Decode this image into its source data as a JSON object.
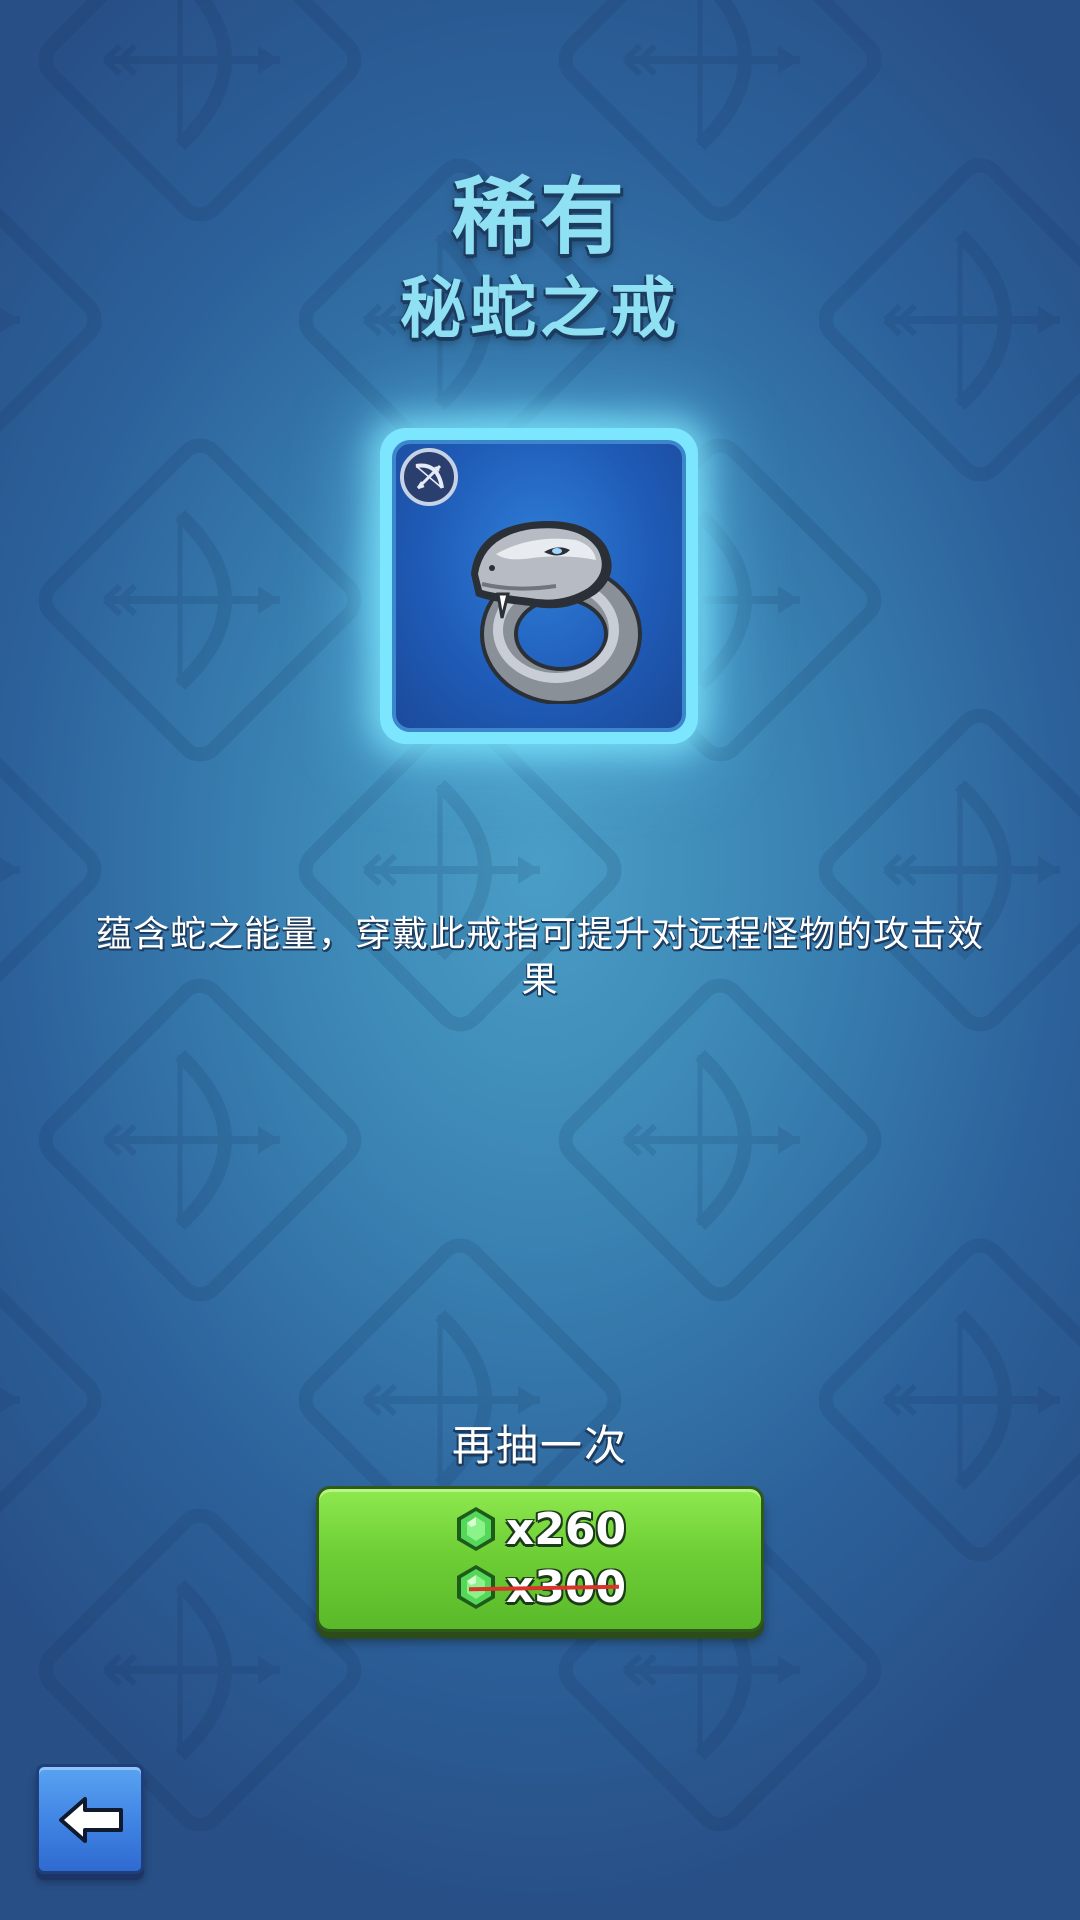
{
  "header": {
    "rarity": "稀有",
    "item_name": "秘蛇之戒"
  },
  "item": {
    "type_icon": "bow-icon",
    "art": "serpent-ring"
  },
  "description": "蕴含蛇之能量，穿戴此戒指可提升对远程怪物的攻击效果",
  "retry": {
    "label": "再抽一次",
    "price_current": "x260",
    "price_original": "x300",
    "currency_icon": "green-gem-icon"
  },
  "back_button": {
    "icon": "back-arrow-icon"
  },
  "colors": {
    "title": "#8fe0f2",
    "button_green": "#6fcf36",
    "back_blue": "#3f83e3",
    "card_glow": "#7de6ff",
    "strike": "#d8342a"
  }
}
